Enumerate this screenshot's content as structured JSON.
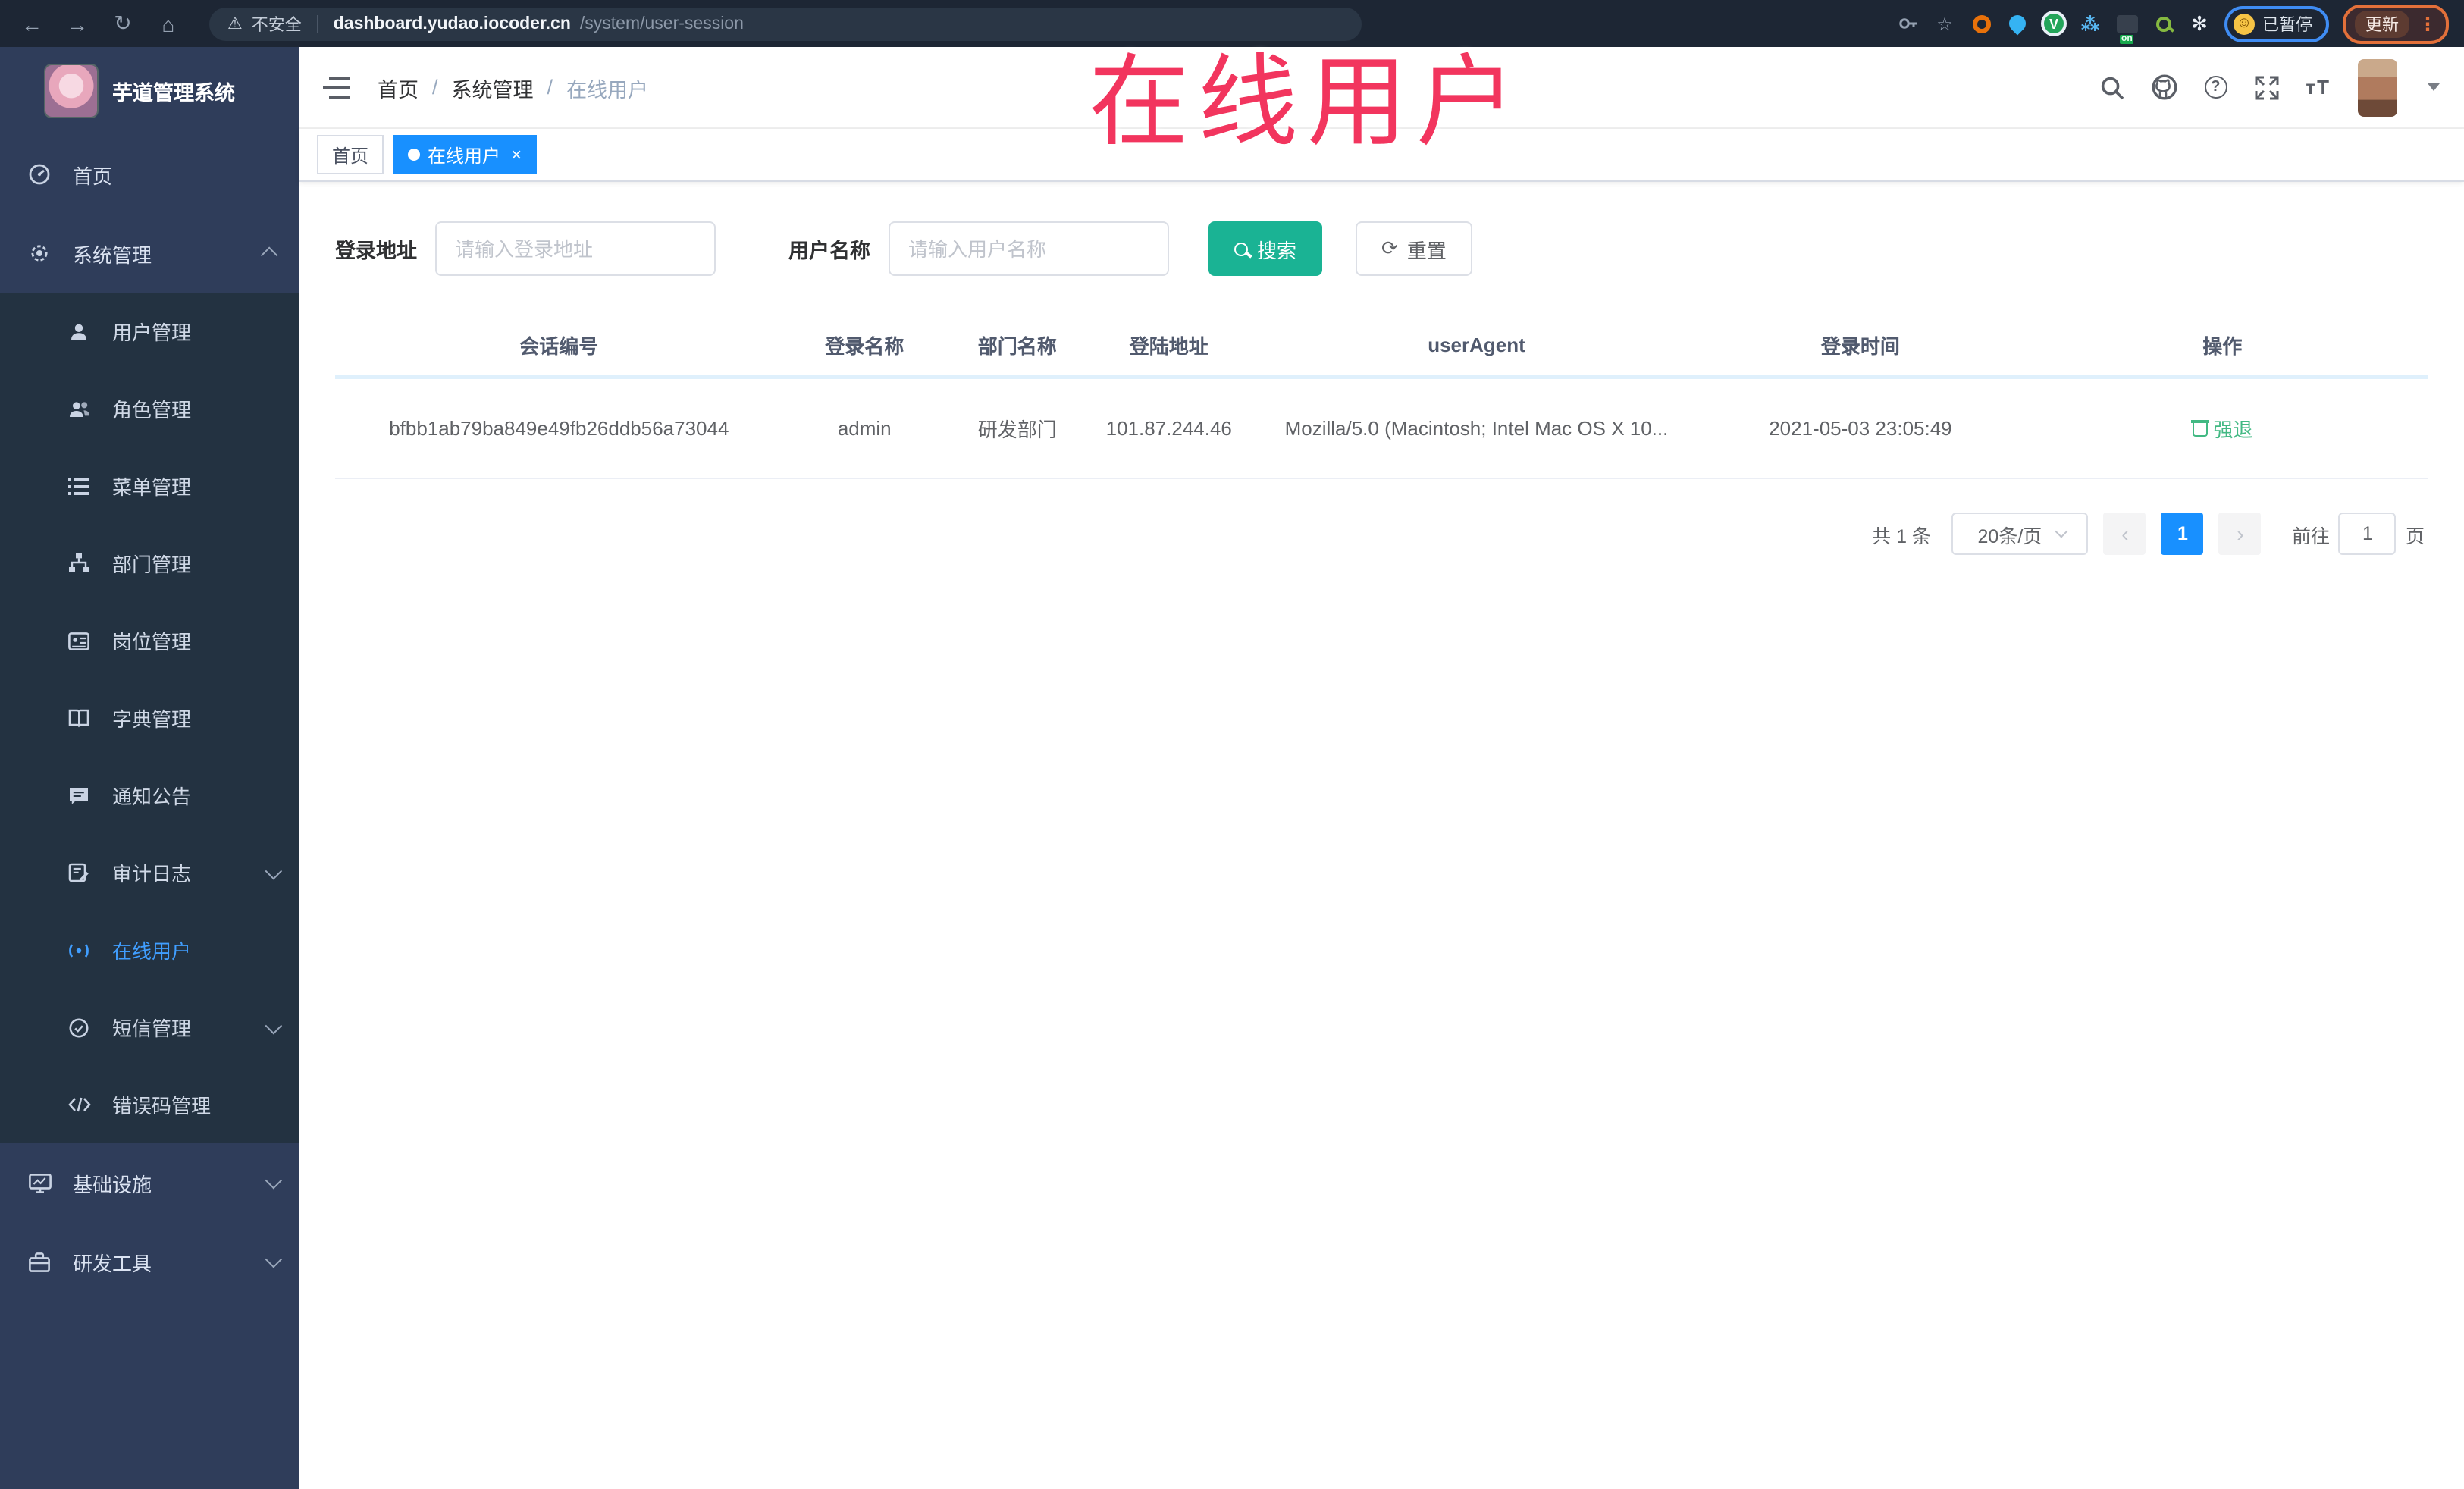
{
  "browser": {
    "security_label": "不安全",
    "url_host": "dashboard.yudao.iocoder.cn",
    "url_path": "/system/user-session",
    "ext_on_badge": "on",
    "paused_label": "已暂停",
    "update_label": "更新"
  },
  "watermark": "在线用户",
  "sidebar": {
    "app_title": "芋道管理系统",
    "items": [
      {
        "label": "首页"
      },
      {
        "label": "系统管理"
      },
      {
        "label": "用户管理"
      },
      {
        "label": "角色管理"
      },
      {
        "label": "菜单管理"
      },
      {
        "label": "部门管理"
      },
      {
        "label": "岗位管理"
      },
      {
        "label": "字典管理"
      },
      {
        "label": "通知公告"
      },
      {
        "label": "审计日志"
      },
      {
        "label": "在线用户"
      },
      {
        "label": "短信管理"
      },
      {
        "label": "错误码管理"
      },
      {
        "label": "基础设施"
      },
      {
        "label": "研发工具"
      }
    ]
  },
  "header": {
    "breadcrumb": [
      "首页",
      "系统管理",
      "在线用户"
    ]
  },
  "tags": [
    {
      "label": "首页"
    },
    {
      "label": "在线用户"
    }
  ],
  "filters": {
    "addr_label": "登录地址",
    "addr_placeholder": "请输入登录地址",
    "name_label": "用户名称",
    "name_placeholder": "请输入用户名称",
    "search_label": "搜索",
    "reset_label": "重置"
  },
  "table": {
    "columns": [
      {
        "label": "会话编号"
      },
      {
        "label": "登录名称"
      },
      {
        "label": "部门名称"
      },
      {
        "label": "登陆地址"
      },
      {
        "label": "userAgent"
      },
      {
        "label": "登录时间"
      },
      {
        "label": "操作"
      }
    ],
    "rows": [
      {
        "session": "bfbb1ab79ba849e49fb26ddb56a73044",
        "username": "admin",
        "dept": "研发部门",
        "address": "101.87.244.46",
        "user_agent": "Mozilla/5.0 (Macintosh; Intel Mac OS X 10...",
        "login_time": "2021-05-03 23:05:49",
        "action_label": "强退"
      }
    ]
  },
  "pagination": {
    "total_label": "共 1 条",
    "page_size": "20条/页",
    "current_page": "1",
    "prev": "‹",
    "next": "›",
    "goto_label": "前往",
    "goto_value": "1",
    "page_unit": "页"
  },
  "colors": {
    "accent_blue": "#1890ff",
    "teal": "#1ab394",
    "action_green": "#42b983",
    "watermark_red": "#f2355e",
    "sidebar_bg": "#2f3d5a",
    "submenu_bg": "#233241"
  }
}
